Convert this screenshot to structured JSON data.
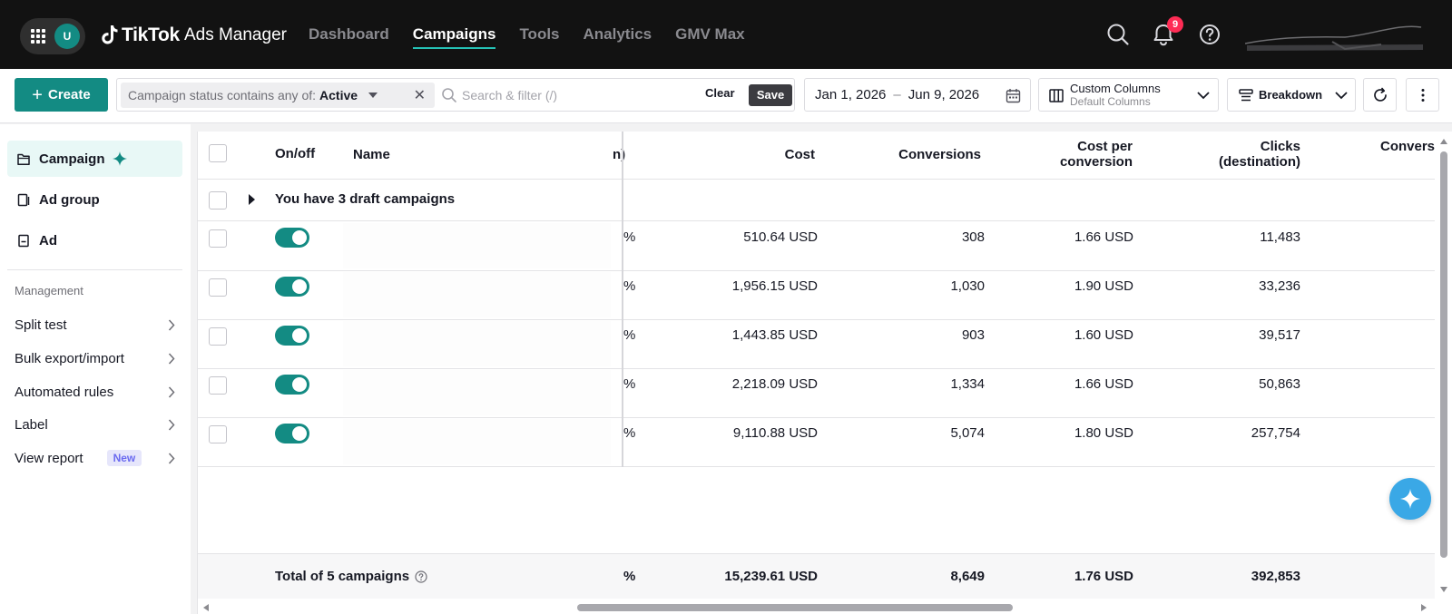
{
  "topbar": {
    "avatar_initial": "U",
    "logo_brand": "TikTok",
    "logo_product": "Ads Manager",
    "nav": [
      {
        "label": "Dashboard",
        "active": false
      },
      {
        "label": "Campaigns",
        "active": true
      },
      {
        "label": "Tools",
        "active": false
      },
      {
        "label": "Analytics",
        "active": false
      },
      {
        "label": "GMV Max",
        "active": false
      }
    ],
    "notification_count": "9",
    "icons": [
      "apps-grid-icon",
      "search-icon",
      "bell-icon",
      "help-icon"
    ]
  },
  "toolbar": {
    "create_label": "Create",
    "filter_prefix": "Campaign status contains any of:",
    "filter_value": "Active",
    "search_placeholder": "Search & filter (/)",
    "clear_label": "Clear",
    "save_label": "Save",
    "date_start": "Jan 1, 2026",
    "date_end": "Jun 9, 2026",
    "columns_title": "Custom Columns",
    "columns_sub": "Default Columns",
    "breakdown_label": "Breakdown"
  },
  "sidebar": {
    "levels": [
      {
        "label": "Campaign",
        "active": true
      },
      {
        "label": "Ad group",
        "active": false
      },
      {
        "label": "Ad",
        "active": false
      }
    ],
    "management_heading": "Management",
    "management_items": [
      {
        "label": "Split test"
      },
      {
        "label": "Bulk export/import"
      },
      {
        "label": "Automated rules"
      },
      {
        "label": "Label"
      },
      {
        "label": "View report",
        "badge": "New"
      }
    ]
  },
  "table": {
    "headers": {
      "onoff": "On/off",
      "name": "Name",
      "partial": "n)",
      "cost": "Cost",
      "conversions": "Conversions",
      "cpc_line1": "Cost per",
      "cpc_line2": "conversion",
      "clicks_line1": "Clicks",
      "clicks_line2": "(destination)",
      "next": "Convers"
    },
    "draft_text": "You have 3 draft campaigns",
    "rows": [
      {
        "on": true,
        "pct": "%",
        "cost": "510.64 USD",
        "conversions": "308",
        "cost_per_conversion": "1.66 USD",
        "clicks": "11,483"
      },
      {
        "on": true,
        "pct": "%",
        "cost": "1,956.15 USD",
        "conversions": "1,030",
        "cost_per_conversion": "1.90 USD",
        "clicks": "33,236"
      },
      {
        "on": true,
        "pct": "%",
        "cost": "1,443.85 USD",
        "conversions": "903",
        "cost_per_conversion": "1.60 USD",
        "clicks": "39,517"
      },
      {
        "on": true,
        "pct": "%",
        "cost": "2,218.09 USD",
        "conversions": "1,334",
        "cost_per_conversion": "1.66 USD",
        "clicks": "50,863"
      },
      {
        "on": true,
        "pct": "%",
        "cost": "9,110.88 USD",
        "conversions": "5,074",
        "cost_per_conversion": "1.80 USD",
        "clicks": "257,754"
      }
    ],
    "total": {
      "label": "Total of 5 campaigns",
      "pct": "%",
      "cost": "15,239.61 USD",
      "conversions": "8,649",
      "cost_per_conversion": "1.76 USD",
      "clicks": "392,853"
    }
  },
  "colors": {
    "accent": "#138b83",
    "badge_red": "#fe2c55",
    "nav_underline": "#25c2b6"
  }
}
